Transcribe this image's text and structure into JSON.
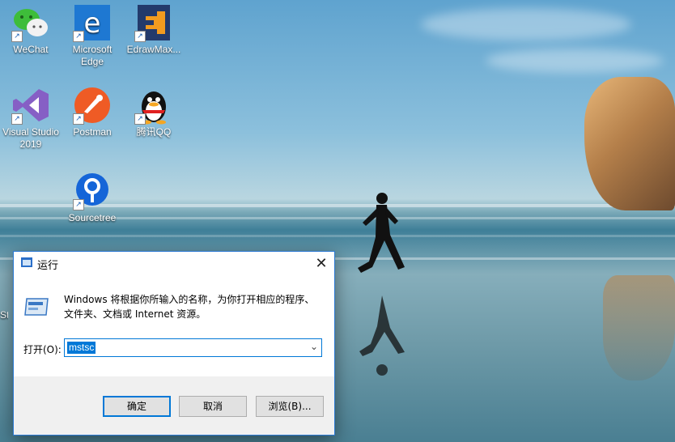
{
  "desktop_icons": [
    {
      "label": "WeChat",
      "icon": "wechat-icon"
    },
    {
      "label": "Microsoft Edge",
      "icon": "edge-icon"
    },
    {
      "label": "EdrawMax...",
      "icon": "edrawmax-icon"
    },
    {
      "label": "Visual Studio 2019",
      "icon": "visual-studio-icon"
    },
    {
      "label": "Postman",
      "icon": "postman-icon"
    },
    {
      "label": "腾讯QQ",
      "icon": "qq-icon"
    },
    {
      "label": "Sourcetree",
      "icon": "sourcetree-icon"
    }
  ],
  "partial_label": "St",
  "run_dialog": {
    "title": "运行",
    "description": "Windows 将根据你所输入的名称，为你打开相应的程序、文件夹、文档或 Internet 资源。",
    "open_label": "打开(O):",
    "input_value": "mstsc",
    "ok_label": "确定",
    "cancel_label": "取消",
    "browse_label": "浏览(B)...",
    "close_glyph": "✕"
  },
  "colors": {
    "accent": "#0078d7",
    "dialog_footer": "#f0f0f0"
  }
}
